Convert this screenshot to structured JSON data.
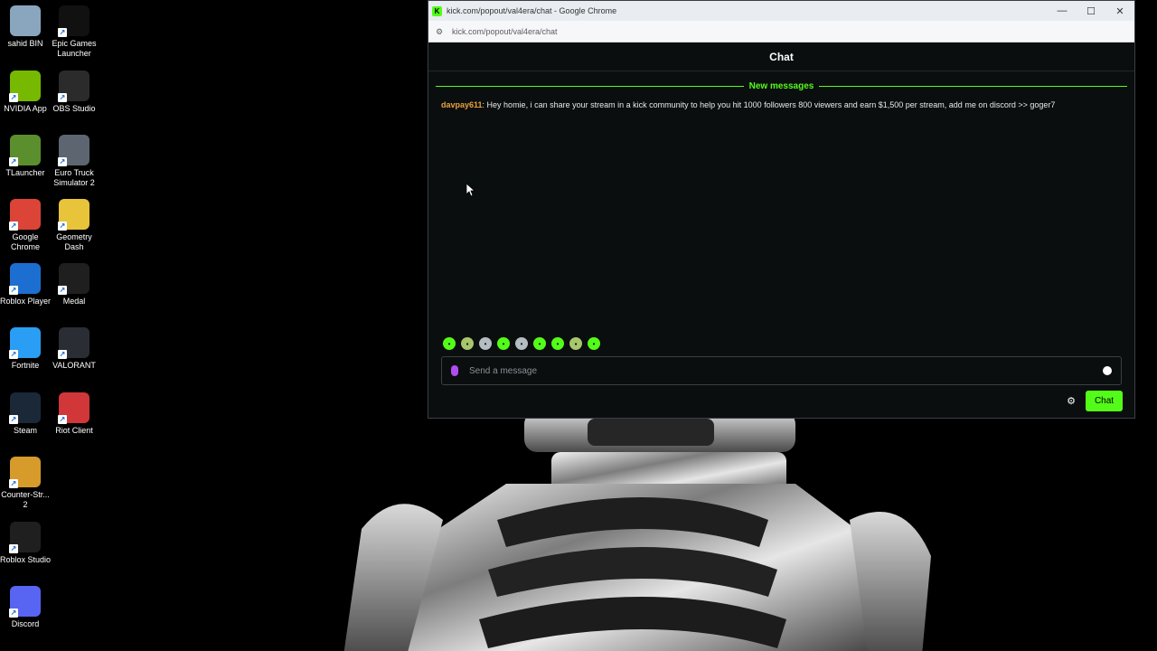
{
  "desktop": {
    "icons": [
      {
        "label": "sahid BIN",
        "icon": "recycle-bin-icon",
        "color": "#8aa6bf"
      },
      {
        "label": "Epic Games Launcher",
        "icon": "epic-games-icon",
        "color": "#111111"
      },
      {
        "label": "NVIDIA App",
        "icon": "nvidia-icon",
        "color": "#76b900"
      },
      {
        "label": "OBS Studio",
        "icon": "obs-icon",
        "color": "#2b2b2b"
      },
      {
        "label": "TLauncher",
        "icon": "tlauncher-icon",
        "color": "#5b8f2e"
      },
      {
        "label": "Euro Truck Simulator 2",
        "icon": "euro-truck-icon",
        "color": "#5d6670"
      },
      {
        "label": "Google Chrome",
        "icon": "chrome-icon",
        "color": "#db4437"
      },
      {
        "label": "Geometry Dash",
        "icon": "geometry-dash-icon",
        "color": "#e7c43a"
      },
      {
        "label": "Roblox Player",
        "icon": "roblox-icon",
        "color": "#1c6fd1"
      },
      {
        "label": "Medal",
        "icon": "medal-icon",
        "color": "#1f1f1f"
      },
      {
        "label": "Fortnite",
        "icon": "fortnite-icon",
        "color": "#2a9df4"
      },
      {
        "label": "VALORANT",
        "icon": "valorant-icon",
        "color": "#2a2d33"
      },
      {
        "label": "Steam",
        "icon": "steam-icon",
        "color": "#1b2838"
      },
      {
        "label": "Riot Client",
        "icon": "riot-client-icon",
        "color": "#d13639"
      },
      {
        "label": "Counter-Str... 2",
        "icon": "counter-strike-icon",
        "color": "#d69b2a"
      },
      {
        "label": "Roblox Studio",
        "icon": "roblox-studio-icon",
        "color": "#1f1f1f"
      },
      {
        "label": "Discord",
        "icon": "discord-icon",
        "color": "#5865f2"
      }
    ]
  },
  "window": {
    "title": "kick.com/popout/val4era/chat - Google Chrome",
    "url": "kick.com/popout/val4era/chat",
    "controls": {
      "minimize": "—",
      "maximize": "☐",
      "close": "✕"
    }
  },
  "chat": {
    "header": "Chat",
    "new_messages": "New messages",
    "messages": [
      {
        "user": "davpay611",
        "text": ": Hey homie, i can share your stream in a kick community to help you hit 1000 followers 800 viewers and earn $1,500 per stream, add me on discord >> goger7"
      }
    ],
    "input_placeholder": "Send a message",
    "send_label": "Chat",
    "emotes": [
      "emote-1",
      "emote-2",
      "emote-3",
      "emote-4",
      "emote-5",
      "emote-6",
      "emote-7",
      "emote-8",
      "emote-9"
    ]
  },
  "colors": {
    "kick_green": "#53fc18",
    "username": "#e8a33c",
    "mic": "#b04cf0"
  }
}
